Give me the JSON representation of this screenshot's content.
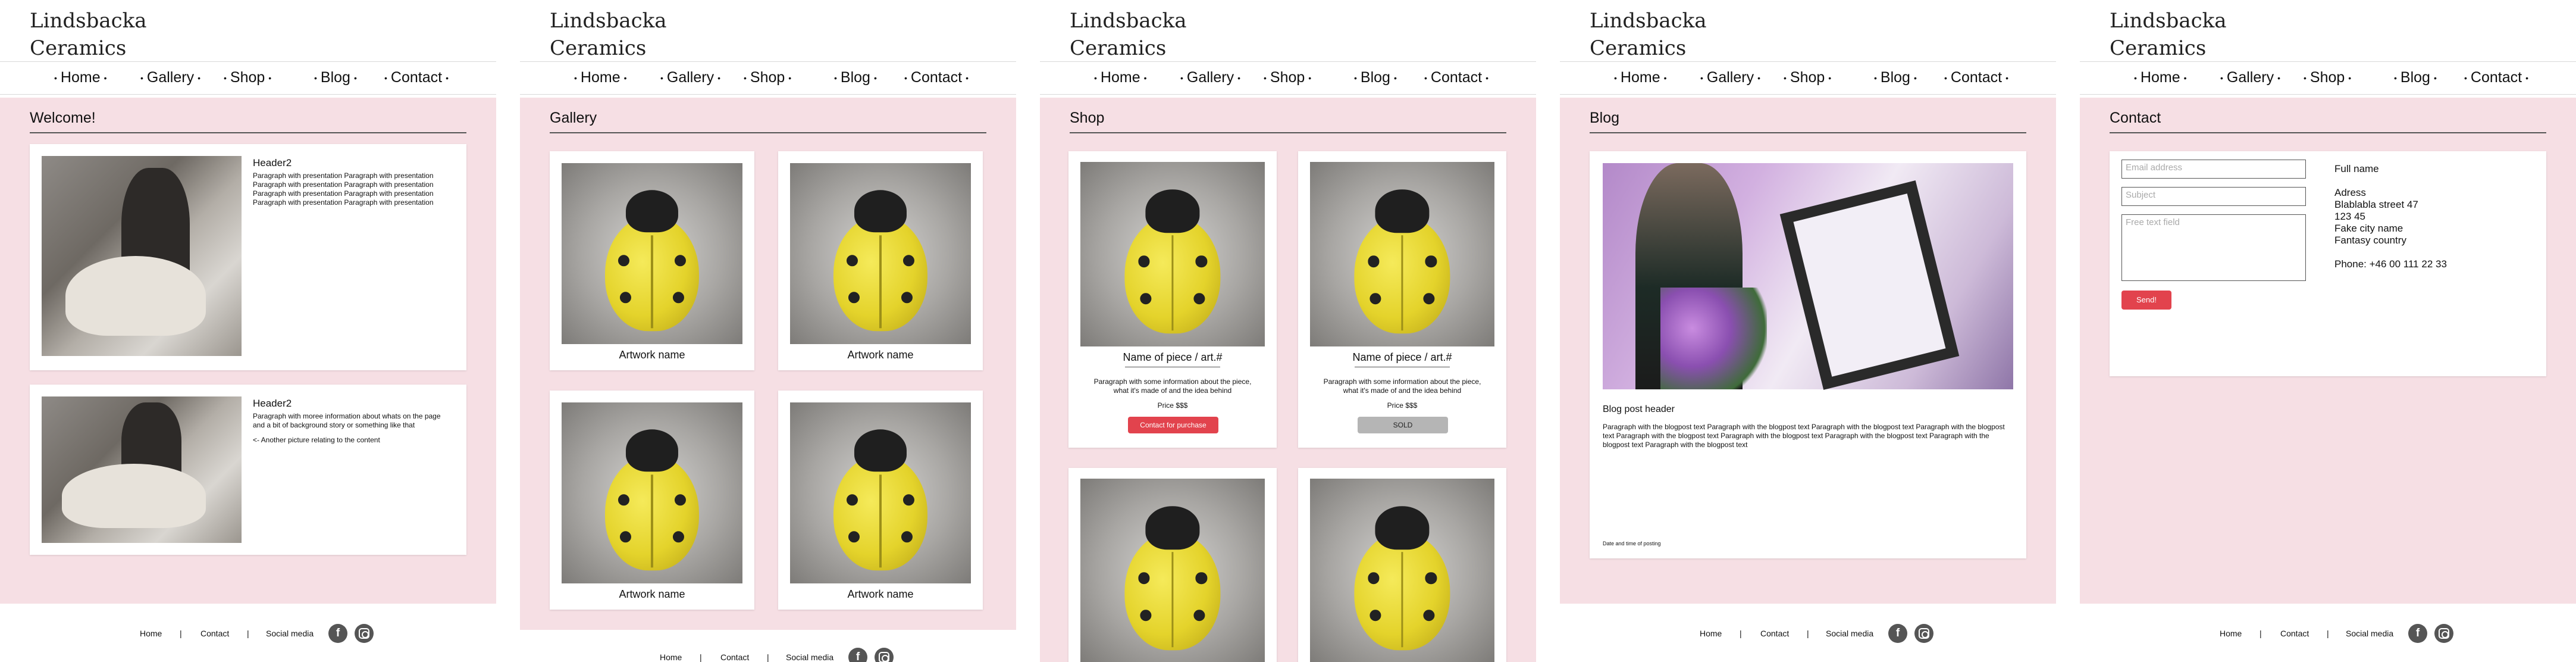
{
  "site": {
    "logo_line1": "Lindsbacka",
    "logo_line2": "Ceramics"
  },
  "nav": {
    "home": "Home",
    "gallery": "Gallery",
    "shop": "Shop",
    "blog": "Blog",
    "contact": "Contact",
    "bullet": "•"
  },
  "footer": {
    "home": "Home",
    "contact": "Contact",
    "social": "Social media",
    "sep": "|",
    "facebook_glyph": "f"
  },
  "home": {
    "title": "Welcome!",
    "card1": {
      "header": "Header2",
      "text": "Paragraph with presentation Paragraph with presentation Paragraph with presentation Paragraph with presentation Paragraph with presentation Paragraph with presentation Paragraph with presentation Paragraph with presentation"
    },
    "card2": {
      "header": "Header2",
      "text": "Paragraph with moree information about whats on the page and a bit of background story or something like that",
      "note": "<- Another picture relating to the content"
    }
  },
  "gallery": {
    "title": "Gallery",
    "items": [
      "Artwork name",
      "Artwork name",
      "Artwork name",
      "Artwork name"
    ]
  },
  "shop": {
    "title": "Shop",
    "items": [
      {
        "name": "Name of piece / art.#",
        "desc": "Paragraph with some information about the piece, what it's made of and the idea behind",
        "price": "Price $$$",
        "button": "Contact for purchase",
        "status": "available"
      },
      {
        "name": "Name of piece / art.#",
        "desc": "Paragraph with some information about the piece, what it's made of and the idea behind",
        "price": "Price $$$",
        "button": "SOLD",
        "status": "sold"
      }
    ]
  },
  "blog": {
    "title": "Blog",
    "post_header": "Blog post header",
    "post_text": "Paragraph with the blogpost text Paragraph with the blogpost text Paragraph with the blogpost text Paragraph with the blogpost text Paragraph with the blogpost text Paragraph with the blogpost text Paragraph with the blogpost text Paragraph with the blogpost text Paragraph with the blogpost text",
    "date": "Date and time of posting"
  },
  "contact": {
    "title": "Contact",
    "email_placeholder": "Email address",
    "subject_placeholder": "Subject",
    "message_placeholder": "Free text field",
    "send": "Send!",
    "full_name": "Full name",
    "adress_label": "Adress",
    "street": "Blablabla street 47",
    "zip": "123 45",
    "city": "Fake city name",
    "country": "Fantasy country",
    "phone": "Phone: +46 00 111 22 33"
  },
  "colors": {
    "pink_bg": "#f6dfe4",
    "red_button": "#e2434d",
    "sold_button": "#b5b5b5"
  }
}
